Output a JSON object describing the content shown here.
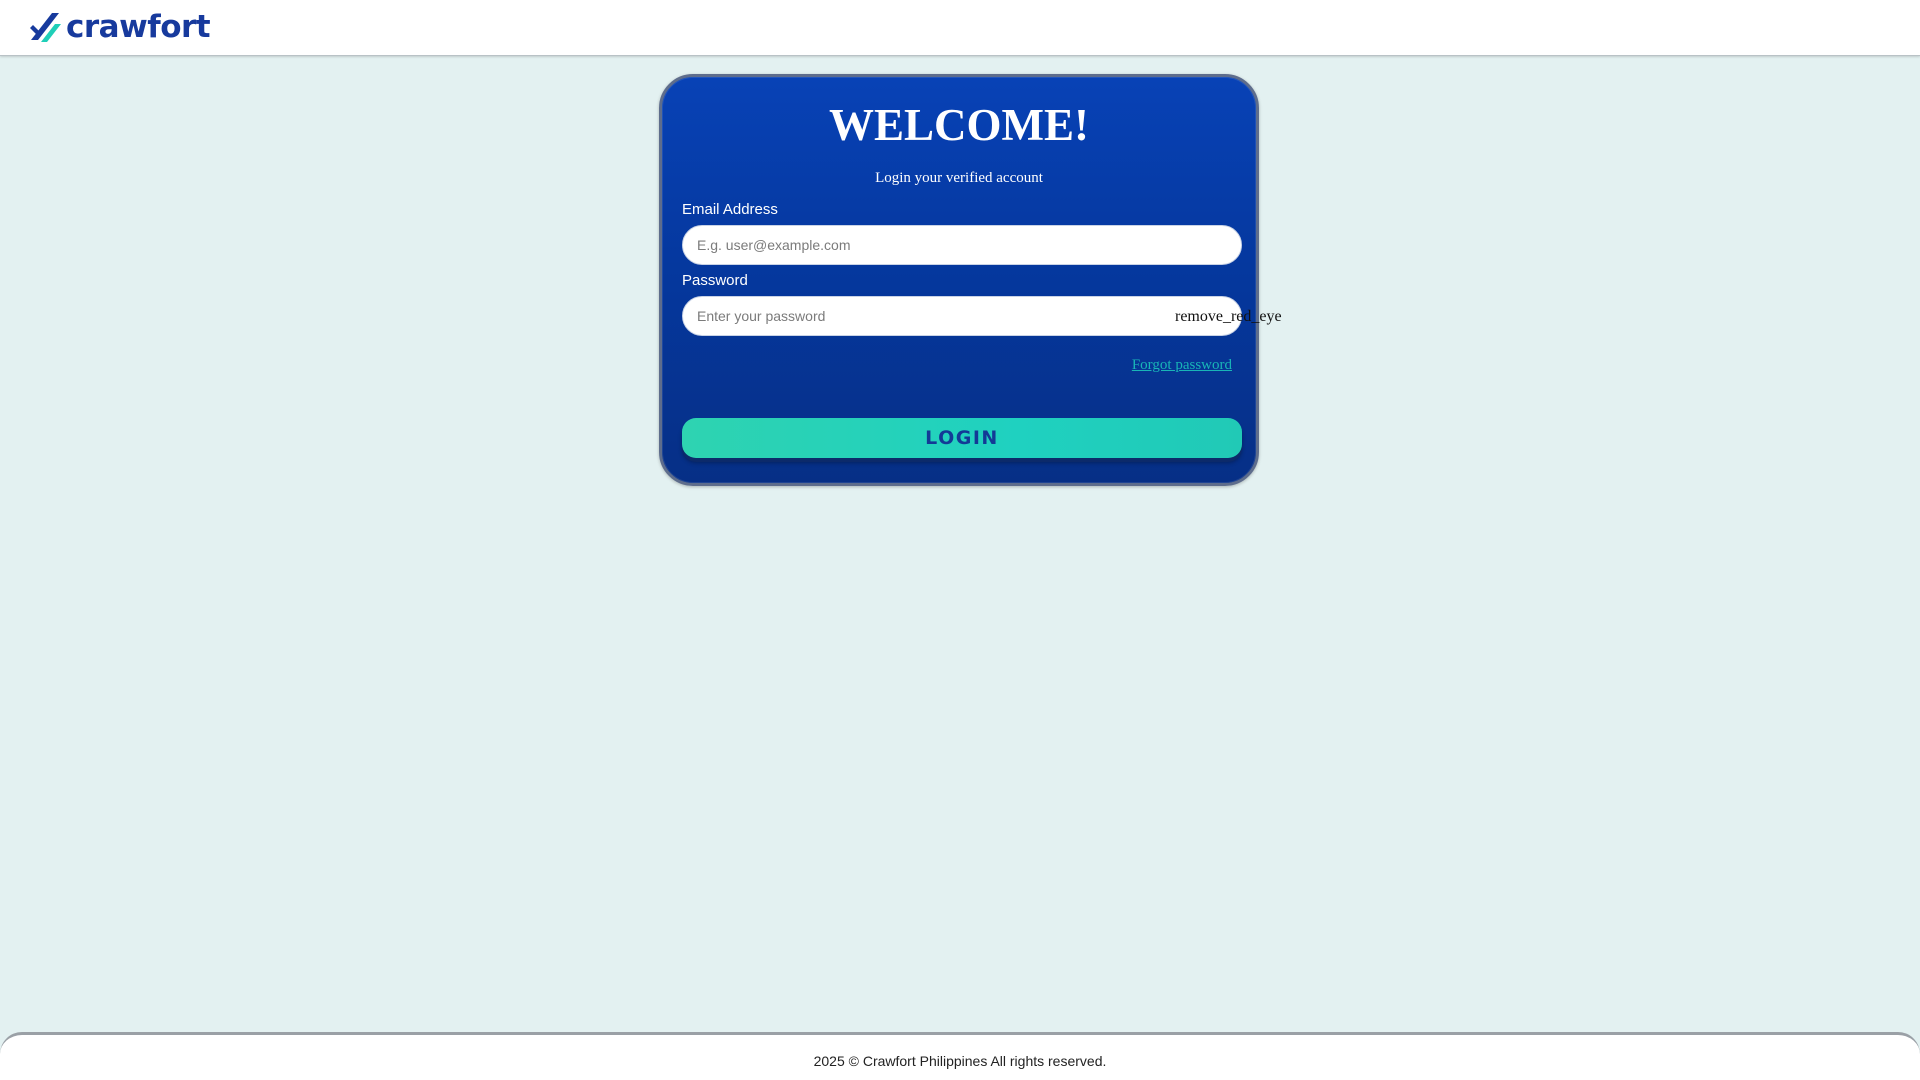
{
  "header": {
    "logo_text": "crawfort",
    "logo_icon": "crawfort-slash-logo-icon",
    "colors": {
      "logo_blue": "#173a9d",
      "logo_teal": "#1fcfb8"
    }
  },
  "login_card": {
    "title": "WELCOME!",
    "subtitle": "Login your verified account",
    "email": {
      "label": "Email Address",
      "value": "",
      "placeholder": "E.g. user@example.com"
    },
    "password": {
      "label": "Password",
      "value": "",
      "placeholder": "Enter your password",
      "toggle_icon_text": "remove_red_eye"
    },
    "forgot_password_label": "Forgot password",
    "login_button_label": "LOGIN",
    "colors": {
      "card_bg": "#05389f",
      "accent_teal": "#21d1bd",
      "link_teal": "#19b5b7"
    }
  },
  "footer": {
    "text": "2025 © Crawfort Philippines All rights reserved."
  }
}
